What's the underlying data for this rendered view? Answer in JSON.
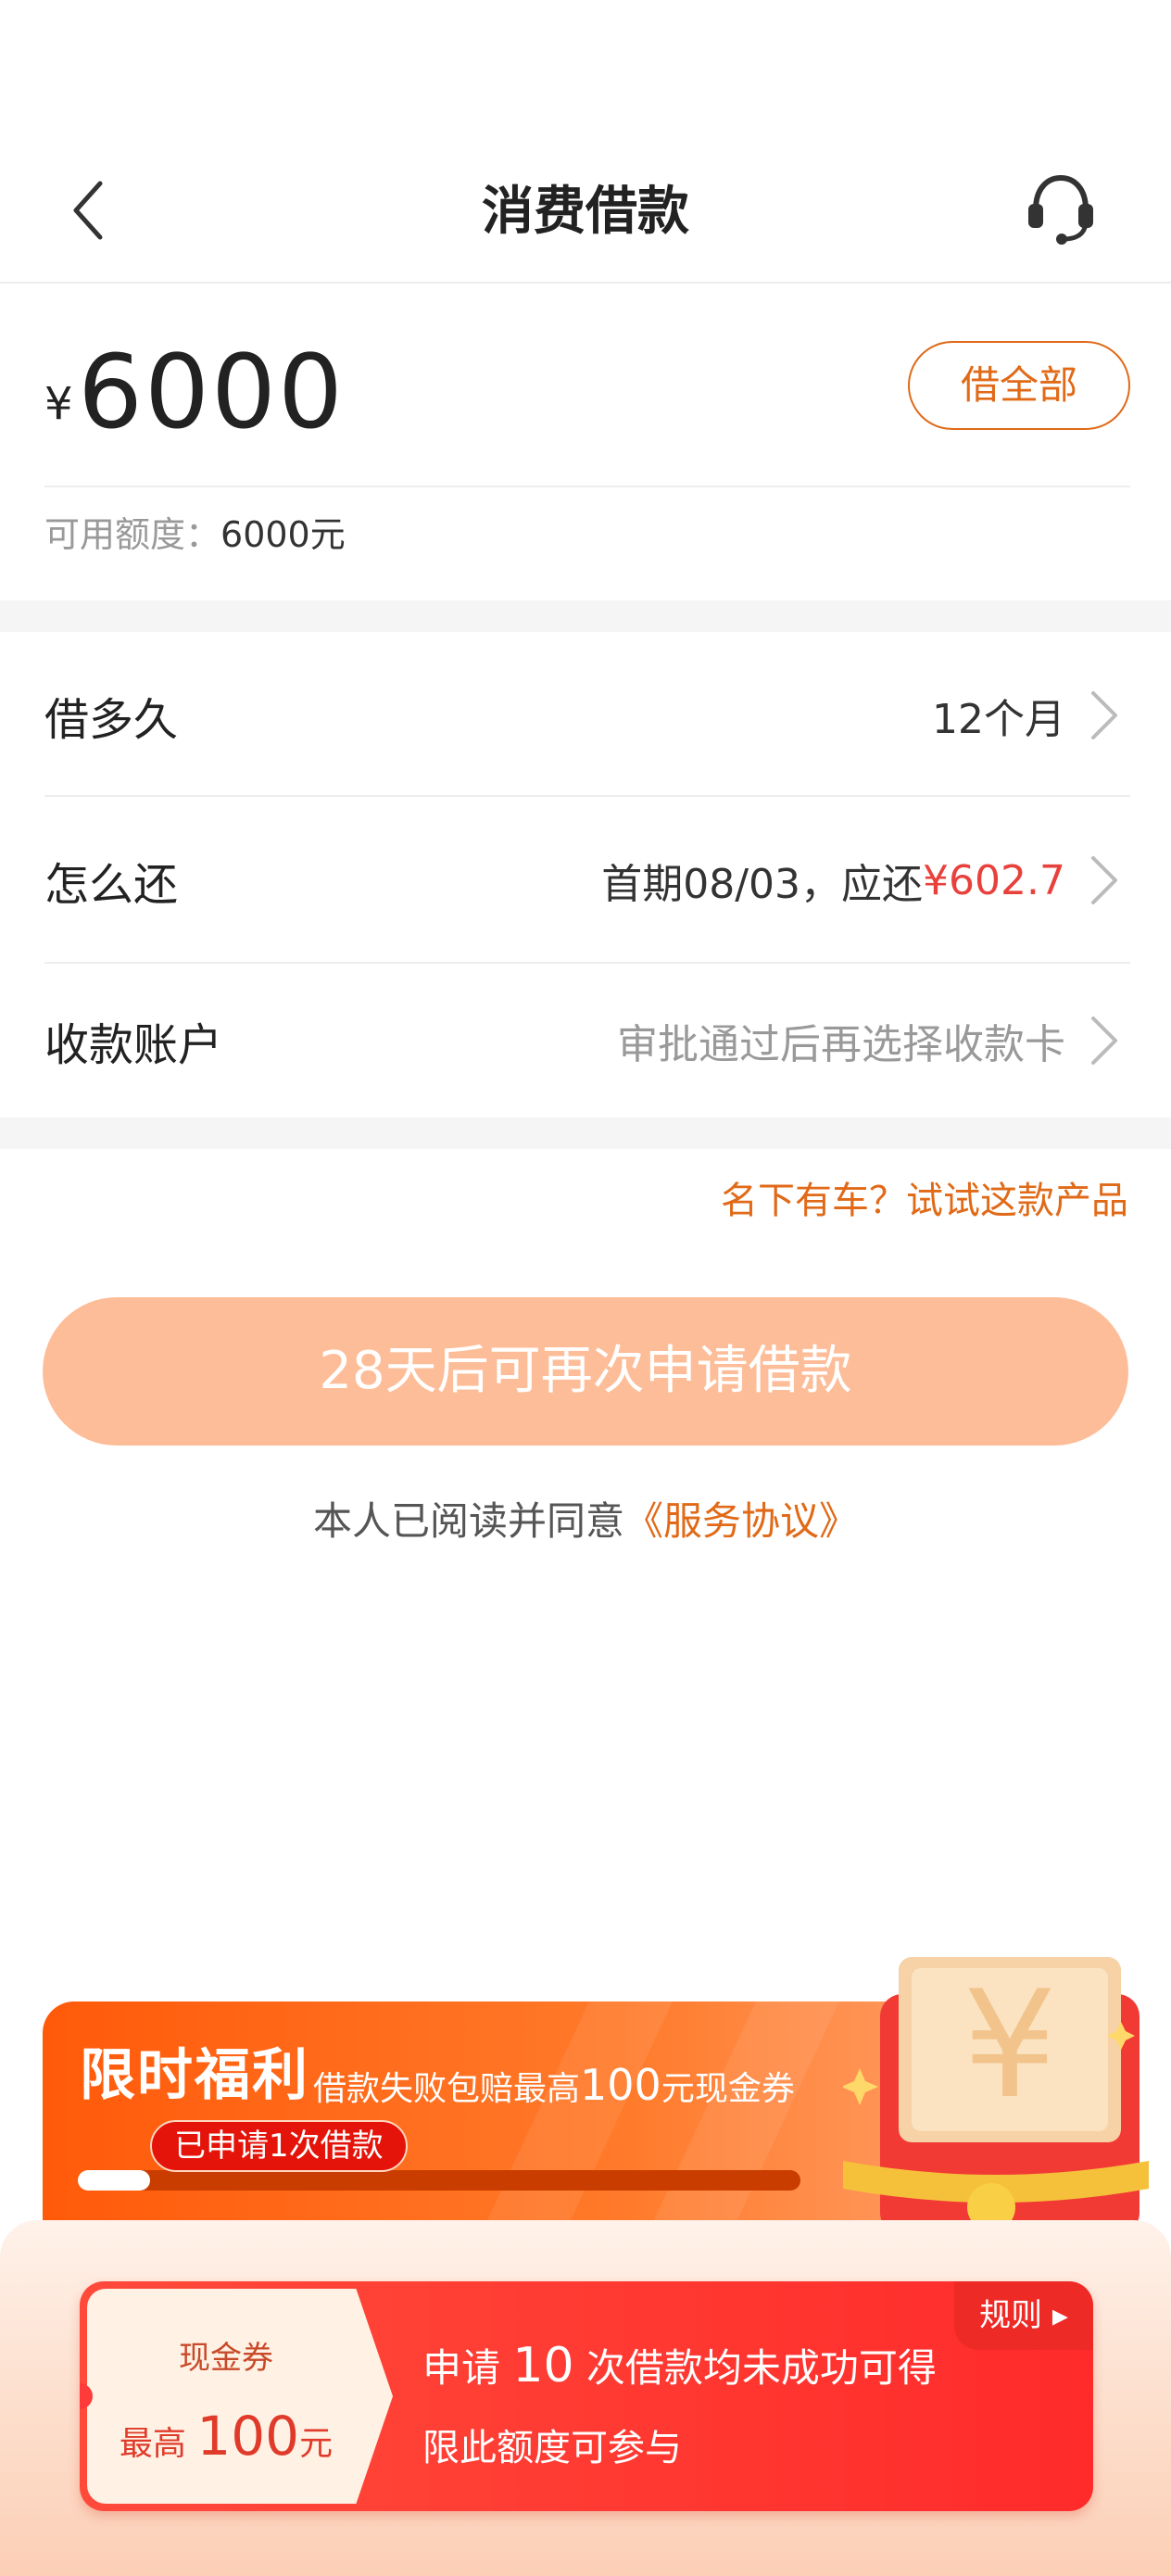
{
  "header": {
    "title": "消费借款",
    "back_icon": "chevron-left-icon",
    "service_icon": "headset-icon"
  },
  "amount": {
    "currency_symbol": "¥",
    "value": "6000",
    "borrow_all_label": "借全部",
    "available_label": "可用额度：",
    "available_value": "6000元"
  },
  "rows": {
    "duration": {
      "label": "借多久",
      "value": "12个月"
    },
    "repayment": {
      "label": "怎么还",
      "value_prefix": "首期08/03，应还",
      "value_amount": "¥602.7"
    },
    "account": {
      "label": "收款账户",
      "value": "审批通过后再选择收款卡"
    }
  },
  "car_link": "名下有车？试试这款产品",
  "apply_button": "28天后可再次申请借款",
  "agreement": {
    "text": "本人已阅读并同意",
    "link": "《服务协议》"
  },
  "promo": {
    "title": "限时福利",
    "subtitle_pre": "借款失败包赔最高",
    "subtitle_num": "100",
    "subtitle_post": "元现金券",
    "progress_tag": "已申请1次借款",
    "progress_fraction": 0.1
  },
  "coupon": {
    "type": "现金券",
    "amount_prefix": "最高",
    "amount_value": "100",
    "amount_unit": "元",
    "line1_pre": "申请",
    "line1_num": "10",
    "line1_post": "次借款均未成功可得",
    "line2": "限此额度可参与",
    "rules_label": "规则 ▸"
  },
  "colors": {
    "accent": "#e06a18",
    "amount_red": "#e8413c",
    "button_disabled": "#fdbd98"
  }
}
